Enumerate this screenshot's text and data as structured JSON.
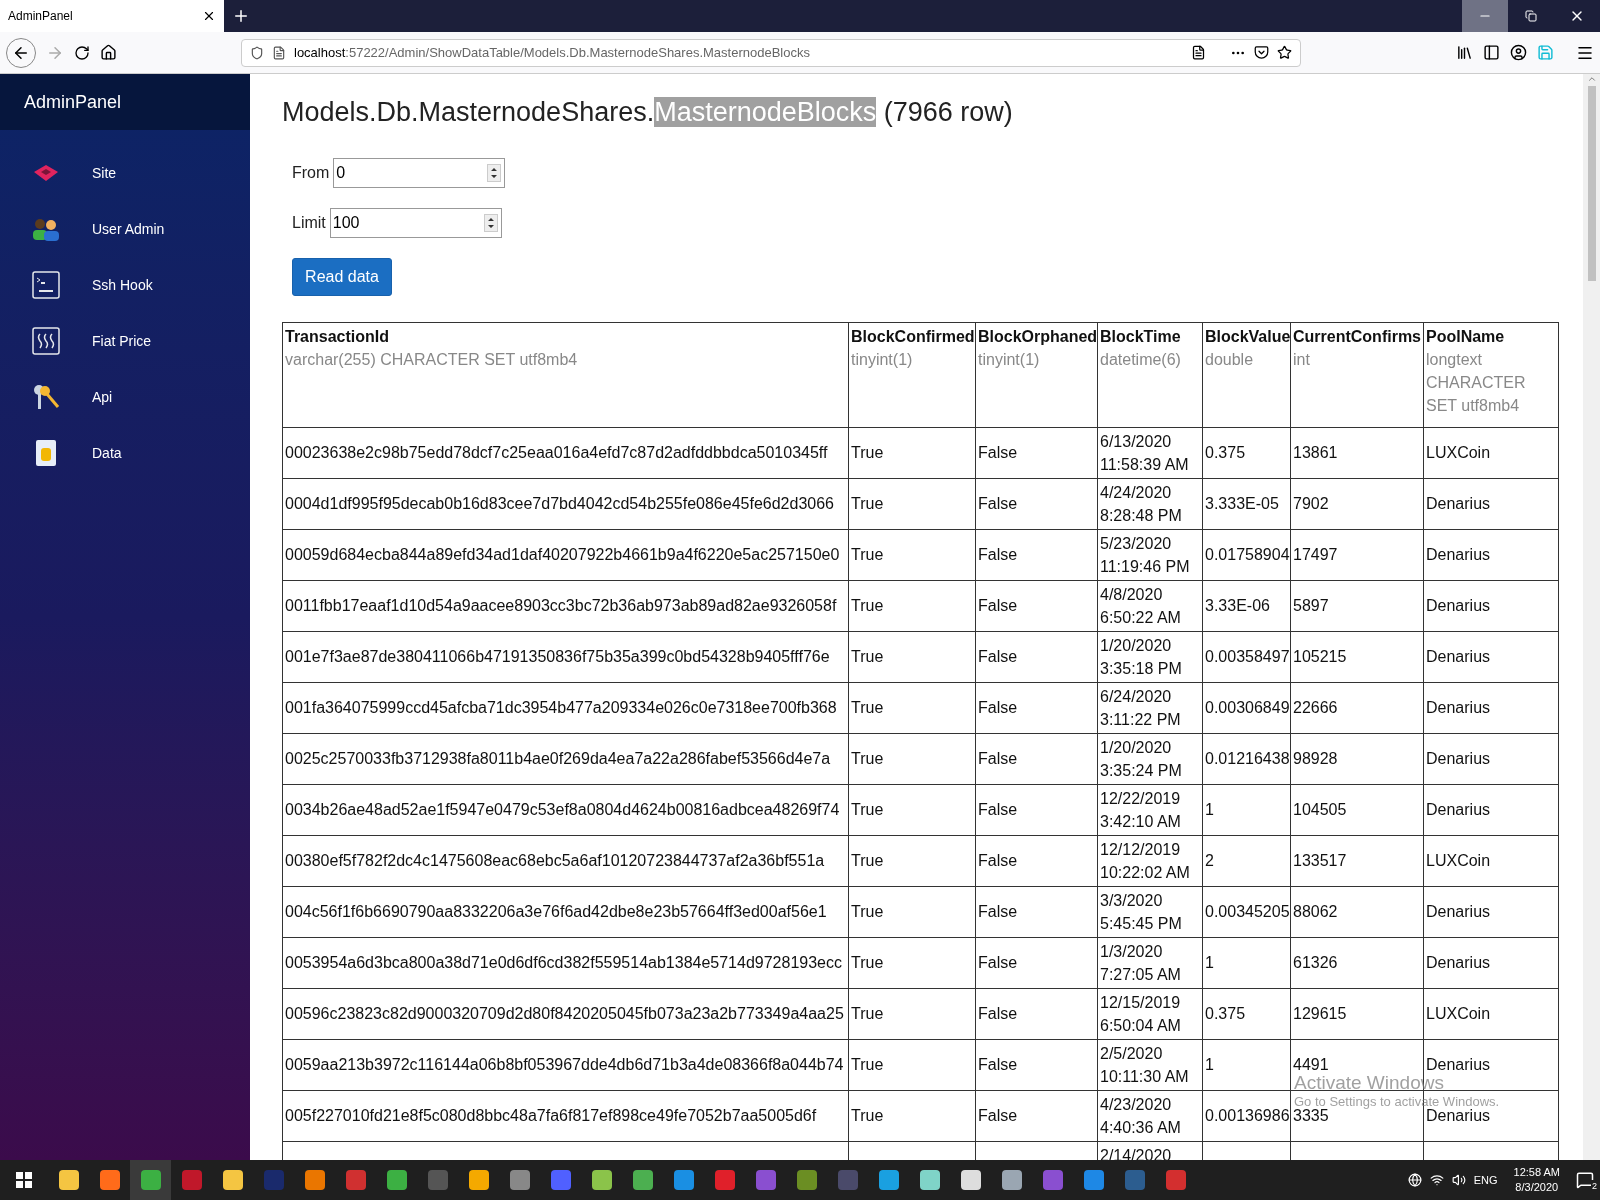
{
  "browser": {
    "tab": {
      "title": "AdminPanel",
      "selected": true
    },
    "url": {
      "host": "localhost",
      "path": ":57222/Admin/ShowDataTable/Models.Db.MasternodeShares.MasternodeBlocks"
    }
  },
  "sidebar": {
    "brand": "AdminPanel",
    "items": [
      {
        "label": "Site",
        "selected": false
      },
      {
        "label": "User Admin",
        "selected": false
      },
      {
        "label": "Ssh Hook",
        "selected": false
      },
      {
        "label": "Fiat Price",
        "selected": false
      },
      {
        "label": "Api",
        "selected": false
      },
      {
        "label": "Data",
        "selected": false
      }
    ]
  },
  "page": {
    "title": {
      "before": "Models.Db.MasternodeShares.",
      "selected_text": "MasternodeBlocks",
      "after": " (7966 row)"
    },
    "form": [
      {
        "label": "From",
        "value": "0"
      },
      {
        "label": "Limit",
        "value": "100"
      }
    ],
    "read_button": "Read data"
  },
  "table": {
    "columns": [
      {
        "name": "TransactionId",
        "type": "varchar(255) CHARACTER SET utf8mb4"
      },
      {
        "name": "BlockConfirmed",
        "type": "tinyint(1)"
      },
      {
        "name": "BlockOrphaned",
        "type": "tinyint(1)"
      },
      {
        "name": "BlockTime",
        "type": "datetime(6)"
      },
      {
        "name": "BlockValue",
        "type": "double"
      },
      {
        "name": "CurrentConfirms",
        "type": "int"
      },
      {
        "name": "PoolName",
        "type": "longtext CHARACTER SET utf8mb4"
      }
    ],
    "rows": [
      [
        "00023638e2c98b75edd78dcf7c25eaa016a4efd7c87d2adfddbbdca5010345ff",
        "True",
        "False",
        "6/13/2020 11:58:39 AM",
        "0.375",
        "13861",
        "LUXCoin"
      ],
      [
        "0004d1df995f95decab0b16d83cee7d7bd4042cd54b255fe086e45fe6d2d3066",
        "True",
        "False",
        "4/24/2020 8:28:48 PM",
        "3.333E-05",
        "7902",
        "Denarius"
      ],
      [
        "00059d684ecba844a89efd34ad1daf40207922b4661b9a4f6220e5ac257150e0",
        "True",
        "False",
        "5/23/2020 11:19:46 PM",
        "0.01758904",
        "17497",
        "Denarius"
      ],
      [
        "0011fbb17eaaf1d10d54a9aacee8903cc3bc72b36ab973ab89ad82ae9326058f",
        "True",
        "False",
        "4/8/2020 6:50:22 AM",
        "3.33E-06",
        "5897",
        "Denarius"
      ],
      [
        "001e7f3ae87de380411066b47191350836f75b35a399c0bd54328b9405fff76e",
        "True",
        "False",
        "1/20/2020 3:35:18 PM",
        "0.00358497",
        "105215",
        "Denarius"
      ],
      [
        "001fa364075999ccd45afcba71dc3954b477a209334e026c0e7318ee700fb368",
        "True",
        "False",
        "6/24/2020 3:11:22 PM",
        "0.00306849",
        "22666",
        "Denarius"
      ],
      [
        "0025c2570033fb3712938fa8011b4ae0f269da4ea7a22a286fabef53566d4e7a",
        "True",
        "False",
        "1/20/2020 3:35:24 PM",
        "0.01216438",
        "98928",
        "Denarius"
      ],
      [
        "0034b26ae48ad52ae1f5947e0479c53ef8a0804d4624b00816adbcea48269f74",
        "True",
        "False",
        "12/22/2019 3:42:10 AM",
        "1",
        "104505",
        "Denarius"
      ],
      [
        "00380ef5f782f2dc4c1475608eac68ebc5a6af10120723844737af2a36bf551a",
        "True",
        "False",
        "12/12/2019 10:22:02 AM",
        "2",
        "133517",
        "LUXCoin"
      ],
      [
        "004c56f1f6b6690790aa8332206a3e76f6ad42dbe8e23b57664ff3ed00af56e1",
        "True",
        "False",
        "3/3/2020 5:45:45 PM",
        "0.00345205",
        "88062",
        "Denarius"
      ],
      [
        "0053954a6d3bca800a38d71e0d6df6cd382f559514ab1384e5714d9728193ecc",
        "True",
        "False",
        "1/3/2020 7:27:05 AM",
        "1",
        "61326",
        "Denarius"
      ],
      [
        "00596c23823c82d9000320709d2d80f8420205045fb073a23a2b773349a4aa25",
        "True",
        "False",
        "12/15/2019 6:50:04 AM",
        "0.375",
        "129615",
        "LUXCoin"
      ],
      [
        "0059aa213b3972c116144a06b8bf053967dde4db6d71b3a4de08366f8a044b74",
        "True",
        "False",
        "2/5/2020 10:11:30 AM",
        "1",
        "4491",
        "Denarius"
      ],
      [
        "005f227010fd21e8f5c080d8bbc48a7fa6f817ef898ce49fe7052b7aa5005d6f",
        "True",
        "False",
        "4/23/2020 4:40:36 AM",
        "0.00136986",
        "3335",
        "Denarius"
      ],
      [
        "",
        "",
        "",
        "2/14/2020",
        "",
        "",
        ""
      ]
    ]
  },
  "os_notice": {
    "title": "Activate Windows",
    "text": "Go to Settings to activate Windows."
  },
  "taskbar": {
    "language": "ENG",
    "time": "12:58 AM",
    "date": "8/3/2020",
    "notifications": "2"
  }
}
